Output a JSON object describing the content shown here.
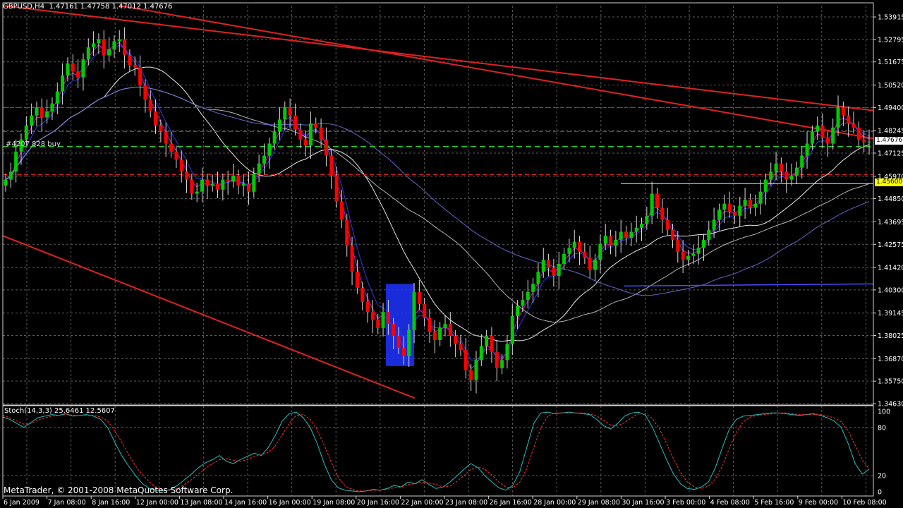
{
  "header": {
    "symbol": "GBPUSD,H4",
    "ohlc": "1.47161 1.47758 1.47012 1.47676"
  },
  "order_label": "#4207 828 buy",
  "stoch_label": "Stoch(14,3,3) 25.6461 12.5607",
  "footer": "MetaTrader, © 2001-2008 MetaQuotes Software Corp.",
  "price_axis": [
    "1.53915",
    "1.52795",
    "1.51675",
    "1.50520",
    "1.49400",
    "1.48245",
    "1.47125",
    "1.45970",
    "1.44850",
    "1.43695",
    "1.42575",
    "1.41420",
    "1.40300",
    "1.39145",
    "1.38025",
    "1.36870",
    "1.35750",
    "1.34630"
  ],
  "current_price": "1.47676",
  "bid_line_price": "1.45600",
  "stoch_axis": [
    "100",
    "80",
    "20",
    "0"
  ],
  "time_axis": [
    "6 Jan 2009",
    "7 Jan 08:00",
    "8 Jan 16:00",
    "12 Jan 00:00",
    "13 Jan 08:00",
    "14 Jan 16:00",
    "16 Jan 00:00",
    "19 Jan 08:00",
    "20 Jan 16:00",
    "22 Jan 00:00",
    "23 Jan 08:00",
    "26 Jan 16:00",
    "28 Jan 00:00",
    "29 Jan 08:00",
    "30 Jan 16:00",
    "3 Feb 00:00",
    "4 Feb 08:00",
    "5 Feb 16:00",
    "9 Feb 00:00",
    "10 Feb 08:00"
  ],
  "colors": {
    "background": "#000000",
    "up_candle": "#00cc00",
    "down_candle": "#ff0000",
    "grid": "#5a5a5a",
    "trendline": "#dd2222",
    "highlight": "#1f33ff",
    "stoch_main": "#20c0c0",
    "stoch_signal": "#ff3030"
  },
  "chart_data": [
    {
      "type": "candlestick",
      "title": "GBPUSD,H4",
      "ylim": [
        1.3463,
        1.5448
      ],
      "grid": true,
      "closes": [
        1.458,
        1.462,
        1.472,
        1.478,
        1.485,
        1.49,
        1.494,
        1.489,
        1.492,
        1.496,
        1.502,
        1.51,
        1.516,
        1.512,
        1.509,
        1.518,
        1.524,
        1.526,
        1.528,
        1.52,
        1.523,
        1.527,
        1.528,
        1.52,
        1.515,
        1.514,
        1.505,
        1.498,
        1.492,
        1.485,
        1.482,
        1.476,
        1.472,
        1.468,
        1.462,
        1.458,
        1.451,
        1.452,
        1.458,
        1.455,
        1.456,
        1.453,
        1.458,
        1.457,
        1.46,
        1.455,
        1.456,
        1.452,
        1.461,
        1.466,
        1.47,
        1.476,
        1.482,
        1.488,
        1.494,
        1.49,
        1.483,
        1.478,
        1.475,
        1.486,
        1.484,
        1.478,
        1.47,
        1.46,
        1.447,
        1.438,
        1.425,
        1.412,
        1.404,
        1.397,
        1.392,
        1.388,
        1.384,
        1.392,
        1.386,
        1.38,
        1.374,
        1.37,
        1.383,
        1.402,
        1.396,
        1.389,
        1.382,
        1.378,
        1.384,
        1.386,
        1.38,
        1.376,
        1.373,
        1.363,
        1.358,
        1.368,
        1.375,
        1.38,
        1.372,
        1.364,
        1.368,
        1.376,
        1.39,
        1.395,
        1.398,
        1.402,
        1.406,
        1.412,
        1.418,
        1.414,
        1.41,
        1.416,
        1.421,
        1.424,
        1.427,
        1.422,
        1.419,
        1.413,
        1.418,
        1.426,
        1.43,
        1.425,
        1.428,
        1.432,
        1.429,
        1.432,
        1.434,
        1.436,
        1.44,
        1.451,
        1.444,
        1.438,
        1.433,
        1.428,
        1.422,
        1.418,
        1.42,
        1.421,
        1.424,
        1.428,
        1.433,
        1.438,
        1.443,
        1.446,
        1.442,
        1.44,
        1.445,
        1.448,
        1.444,
        1.446,
        1.452,
        1.458,
        1.462,
        1.466,
        1.462,
        1.458,
        1.46,
        1.464,
        1.47,
        1.476,
        1.482,
        1.485,
        1.479,
        1.476,
        1.484,
        1.494,
        1.49,
        1.486,
        1.484,
        1.478,
        1.477,
        1.477
      ]
    },
    {
      "type": "line",
      "title": "Stoch(14,3,3)",
      "ylim": [
        0,
        100
      ],
      "grid": true,
      "series": [
        {
          "name": "Stoch main",
          "values": [
            93,
            90,
            85,
            80,
            86,
            92,
            94,
            96,
            95,
            97,
            94,
            95,
            96,
            94,
            90,
            80,
            62,
            45,
            32,
            20,
            10,
            4,
            2,
            1,
            3,
            8,
            15,
            22,
            30,
            36,
            40,
            45,
            38,
            35,
            40,
            44,
            48,
            45,
            55,
            70,
            88,
            97,
            99,
            92,
            80,
            60,
            35,
            15,
            5,
            2,
            1,
            0,
            1,
            3,
            2,
            4,
            8,
            6,
            12,
            10,
            15,
            9,
            4,
            6,
            12,
            20,
            28,
            35,
            30,
            20,
            12,
            5,
            2,
            8,
            25,
            55,
            85,
            98,
            99,
            97,
            98,
            99,
            98,
            97,
            96,
            90,
            82,
            78,
            85,
            94,
            98,
            99,
            95,
            80,
            60,
            40,
            22,
            10,
            4,
            3,
            6,
            12,
            30,
            55,
            78,
            90,
            94,
            95,
            96,
            97,
            98,
            98,
            97,
            96,
            95,
            96,
            97,
            95,
            92,
            88,
            80,
            60,
            35,
            22,
            28
          ]
        },
        {
          "name": "Stoch signal",
          "values": [
            95,
            92,
            88,
            84,
            85,
            89,
            92,
            94,
            95,
            96,
            95,
            95,
            95,
            95,
            93,
            88,
            76,
            62,
            46,
            32,
            21,
            12,
            5,
            2,
            2,
            4,
            9,
            15,
            22,
            29,
            35,
            40,
            41,
            39,
            38,
            40,
            44,
            46,
            49,
            57,
            71,
            85,
            95,
            96,
            90,
            77,
            58,
            37,
            18,
            7,
            3,
            1,
            1,
            2,
            2,
            3,
            5,
            6,
            9,
            10,
            12,
            11,
            9,
            6,
            7,
            13,
            20,
            28,
            31,
            28,
            21,
            12,
            6,
            5,
            12,
            29,
            55,
            79,
            94,
            98,
            98,
            98,
            98,
            98,
            97,
            94,
            89,
            83,
            82,
            86,
            92,
            97,
            97,
            91,
            78,
            60,
            41,
            24,
            12,
            6,
            4,
            7,
            16,
            32,
            54,
            74,
            87,
            93,
            95,
            96,
            97,
            98,
            98,
            97,
            96,
            96,
            96,
            96,
            94,
            92,
            87,
            76,
            58,
            40,
            28
          ]
        }
      ]
    }
  ]
}
